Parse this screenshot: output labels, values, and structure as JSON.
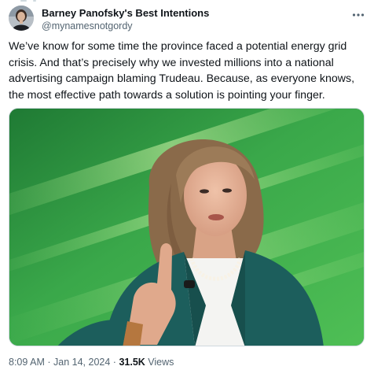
{
  "tweet": {
    "author": {
      "display_name": "Barney Panofsky's Best Intentions",
      "handle": "@mynamesnotgordy"
    },
    "text": "We’ve know for some time the province faced a potential energy grid crisis. And that’s precisely why we invested millions into a national advertising campaign blaming Trudeau. Because, as everyone knows, the most effective path towards a solution is pointing your finger.",
    "time": "8:09 AM",
    "separator": "·",
    "date": "Jan 14, 2024",
    "views_count": "31.5K",
    "views_label": "Views"
  },
  "icons": {
    "more": "more-horizontal-icon"
  },
  "colors": {
    "text_primary": "#0f1419",
    "text_secondary": "#536471",
    "border": "#cfd9de",
    "photo_background": "#2d8a3e",
    "jacket": "#1c5e5c"
  }
}
